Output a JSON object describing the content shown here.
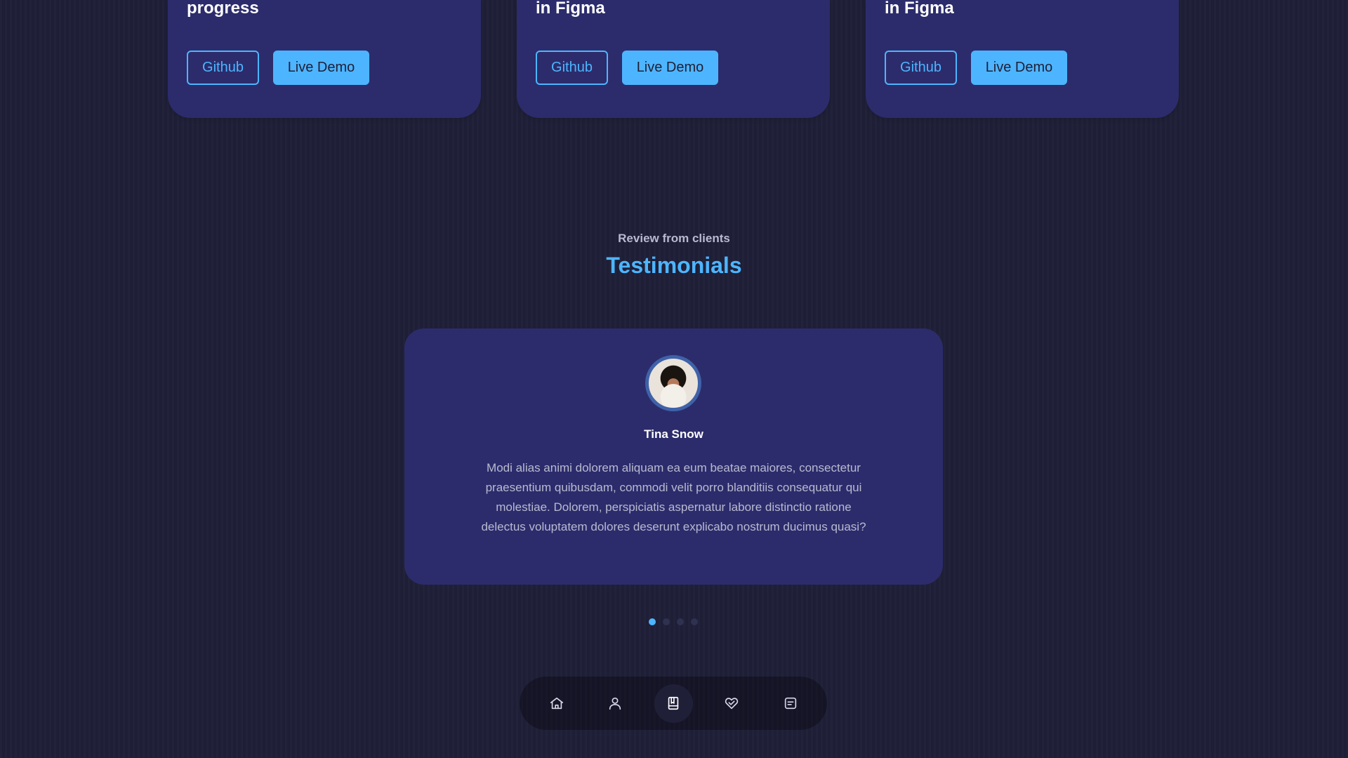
{
  "portfolio": {
    "cards": [
      {
        "title": "progress",
        "github_label": "Github",
        "demo_label": "Live Demo"
      },
      {
        "title": "in Figma",
        "github_label": "Github",
        "demo_label": "Live Demo"
      },
      {
        "title": "in Figma",
        "github_label": "Github",
        "demo_label": "Live Demo"
      }
    ]
  },
  "testimonials": {
    "subtitle": "Review from clients",
    "title": "Testimonials",
    "active": {
      "name": "Tina Snow",
      "review": "Modi alias animi dolorem aliquam ea eum beatae maiores, consectetur praesentium quibusdam, commodi velit porro blanditiis consequatur qui molestiae. Dolorem, perspiciatis aspernatur labore distinctio ratione delectus voluptatem dolores deserunt explicabo nostrum ducimus quasi?"
    },
    "pagination": {
      "count": 4,
      "active_index": 0
    }
  },
  "nav": {
    "items": [
      {
        "icon": "home-icon",
        "active": false
      },
      {
        "icon": "user-icon",
        "active": false
      },
      {
        "icon": "book-icon",
        "active": true
      },
      {
        "icon": "services-icon",
        "active": false
      },
      {
        "icon": "message-icon",
        "active": false
      }
    ]
  },
  "colors": {
    "background": "#1f1f38",
    "card": "#2c2c6c",
    "accent": "#4db5ff",
    "muted_text": "#b9bad0"
  }
}
